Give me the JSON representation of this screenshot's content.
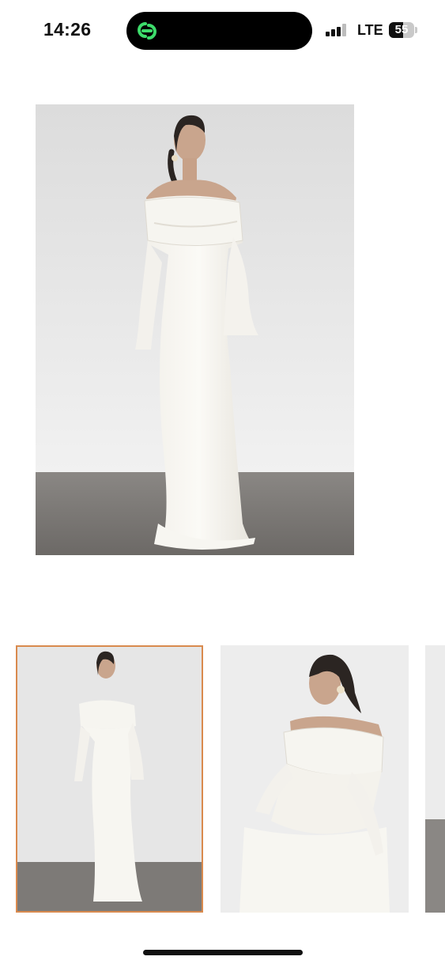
{
  "status_bar": {
    "time": "14:26",
    "network": "LTE",
    "battery_percent": "55",
    "battery_level": 0.55,
    "island_icon": "link-chain-icon",
    "island_icon_color": "#3ddc6b"
  },
  "product": {
    "main_image": "model-in-white-off-shoulder-gown-image",
    "selected_thumbnail_index": 0,
    "thumbnails": [
      {
        "image": "full-length-front-view-thumbnail"
      },
      {
        "image": "close-up-pose-thumbnail"
      },
      {
        "image": "partial-thumbnail"
      }
    ],
    "accent_color": "#d98a4e"
  }
}
